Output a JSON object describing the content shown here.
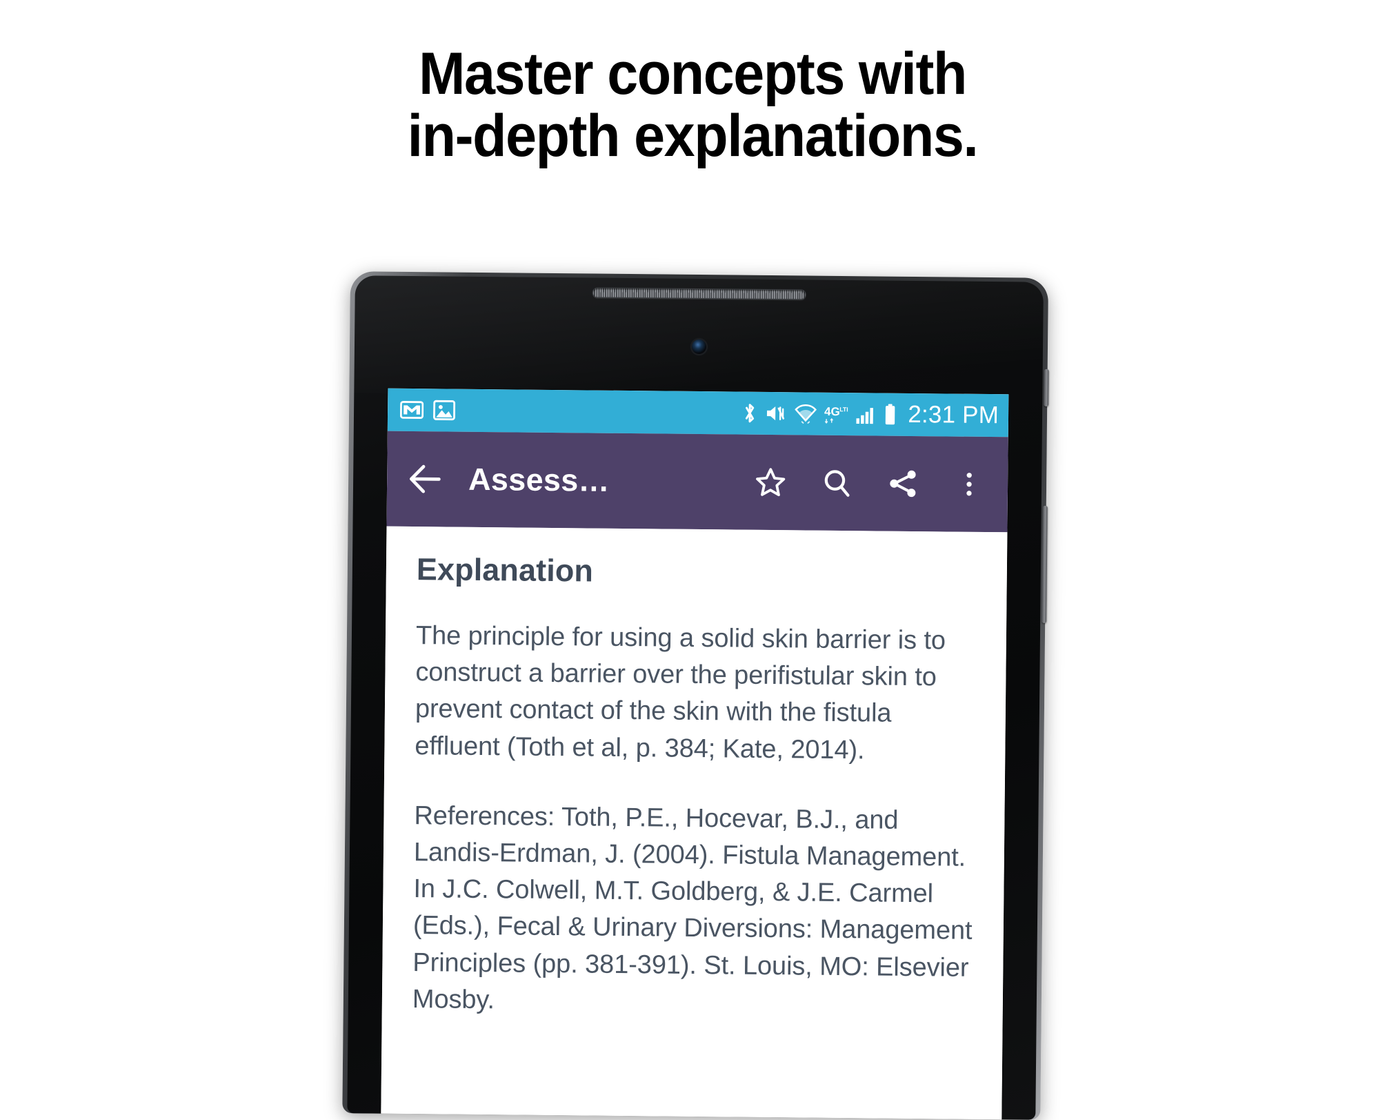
{
  "headline": {
    "text": "Master concepts with\nin-depth explanations."
  },
  "colors": {
    "status_bar": "#32aed6",
    "toolbar": "#4e4169",
    "content_text": "#4a5563",
    "heading_text": "#3f4a59",
    "headline_text": "#000000",
    "screen_background": "#ffffff",
    "device_bezel": "#0c0d0e"
  },
  "device": {
    "type": "android-tablet",
    "speaker_grille": "speaker-grille",
    "front_camera": "front-camera-icon",
    "side_button": "volume-rocker"
  },
  "status_bar": {
    "left_icons": [
      {
        "name": "gmail-icon",
        "label": "Gmail notification"
      },
      {
        "name": "photo-icon",
        "label": "Photo notification"
      }
    ],
    "right_icons": [
      {
        "name": "bluetooth-icon",
        "label": "Bluetooth"
      },
      {
        "name": "vibrate-muted-icon",
        "label": "Ringer silenced / vibrate"
      },
      {
        "name": "wifi-icon",
        "label": "Wi-Fi"
      },
      {
        "name": "4g-lte-icon",
        "label": "4G LTE"
      },
      {
        "name": "signal-bars-icon",
        "label": "Cellular signal"
      },
      {
        "name": "battery-icon",
        "label": "Battery full"
      }
    ],
    "network_label": "4G",
    "network_sub": "LTE",
    "clock": "2:31 PM"
  },
  "toolbar": {
    "back_label": "Navigate up",
    "title": "Assess…",
    "actions": [
      {
        "name": "star-icon",
        "label": "Bookmark"
      },
      {
        "name": "search-icon",
        "label": "Search"
      },
      {
        "name": "share-icon",
        "label": "Share"
      },
      {
        "name": "overflow-menu-icon",
        "label": "More options"
      }
    ]
  },
  "content": {
    "heading": "Explanation",
    "paragraphs": [
      "The principle for using a solid skin barrier is to construct a barrier over the perifistular skin to prevent contact of the skin with the fistula effluent (Toth et al, p. 384; Kate, 2014).",
      "References: Toth, P.E., Hocevar, B.J., and Landis-Erdman, J. (2004). Fistula Management. In J.C. Colwell, M.T. Goldberg, & J.E. Carmel (Eds.), Fecal & Urinary Diversions: Management Principles (pp. 381-391). St. Louis, MO: Elsevier Mosby."
    ]
  }
}
